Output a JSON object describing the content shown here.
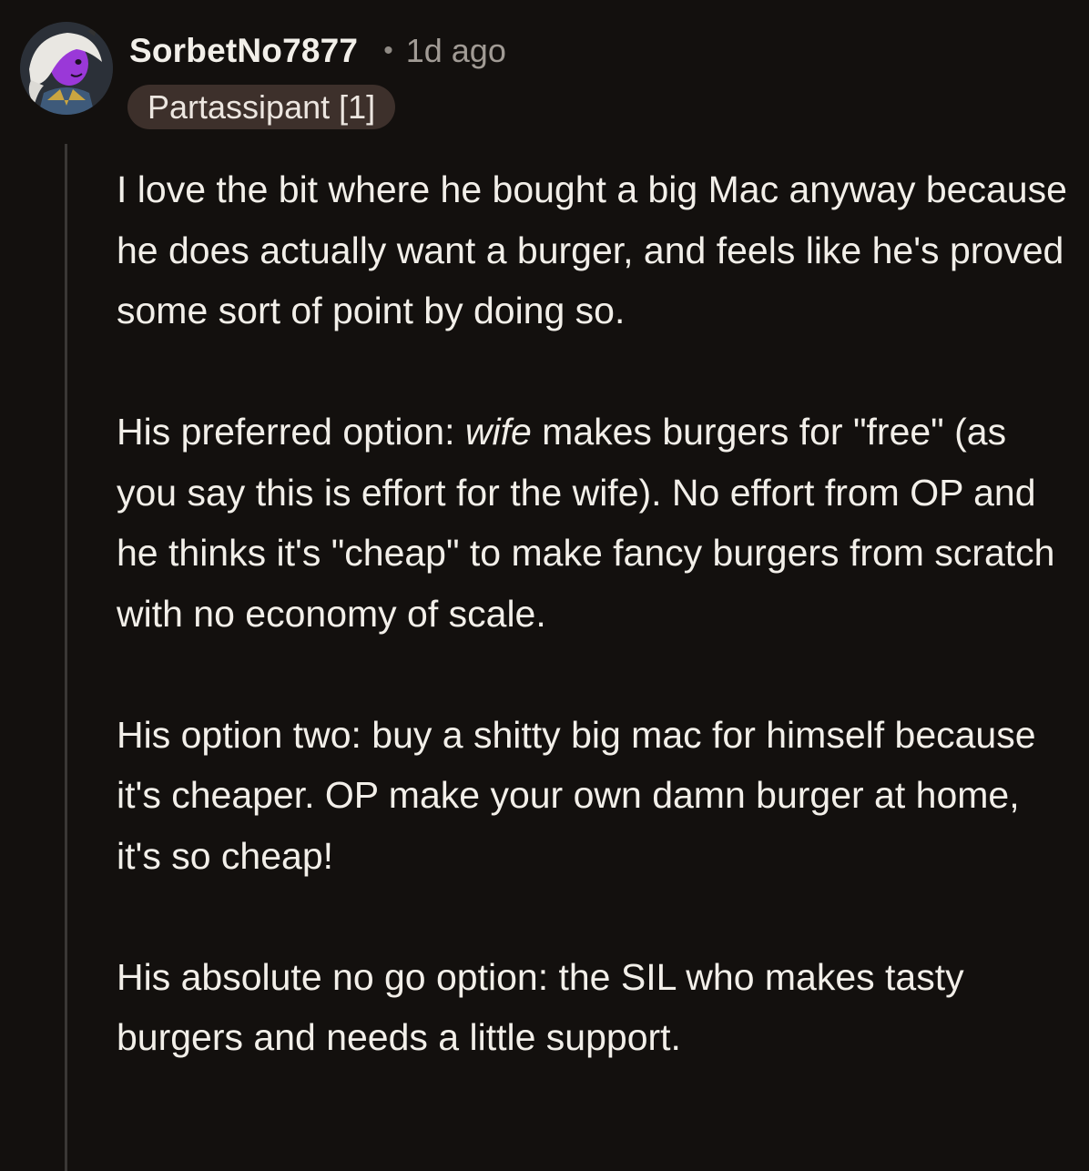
{
  "comment": {
    "username": "SorbetNo7877",
    "separator": "•",
    "timestamp": "1d ago",
    "flair": "Partassipant [1]",
    "avatar_icon": "avatar-icon",
    "paragraphs": [
      "I love the bit where he bought a big Mac anyway because he does actually want a burger, and feels like he's proved some sort of point by doing so.",
      {
        "before": "His preferred option: ",
        "emphasis": "wife",
        "after": " makes burgers for \"free\" (as you say this is effort for the wife). No effort from OP and he thinks it's \"cheap\" to make fancy burgers from scratch with no economy of scale."
      },
      "His option two: buy a shitty big mac for himself because it's cheaper. OP make your own damn burger at home, it's so cheap!",
      "His absolute no go option: the SIL who makes tasty burgers and needs a little support."
    ]
  }
}
